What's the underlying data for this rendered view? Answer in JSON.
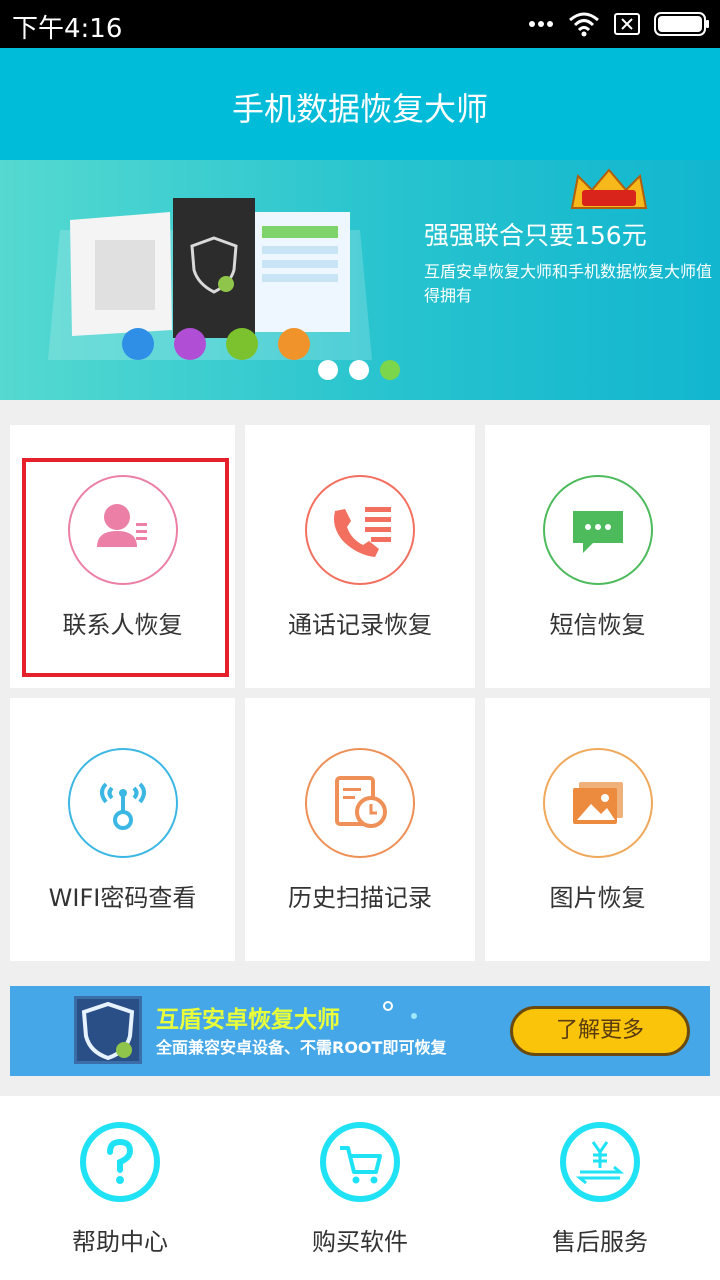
{
  "status_bar": {
    "time": "下午4:16"
  },
  "header": {
    "title": "手机数据恢复大师"
  },
  "banner": {
    "headline": "强强联合只要156元",
    "subtitle": "互盾安卓恢复大师和手机数据恢复大师值得拥有",
    "active_slide": 3,
    "slide_count": 3
  },
  "grid": {
    "items": [
      {
        "label": "联系人恢复",
        "icon": "contact-icon",
        "color": "#ec7fa6"
      },
      {
        "label": "通话记录恢复",
        "icon": "call-log-icon",
        "color": "#f36f5f"
      },
      {
        "label": "短信恢复",
        "icon": "sms-icon",
        "color": "#4dbb5c"
      },
      {
        "label": "WIFI密码查看",
        "icon": "wifi-key-icon",
        "color": "#3cb7e3"
      },
      {
        "label": "历史扫描记录",
        "icon": "history-icon",
        "color": "#ee9057"
      },
      {
        "label": "图片恢复",
        "icon": "photo-icon",
        "color": "#f0a85b"
      }
    ]
  },
  "ad": {
    "title": "互盾安卓恢复大师",
    "subtitle": "全面兼容安卓设备、不需ROOT即可恢复",
    "button": "了解更多"
  },
  "bottom_nav": {
    "items": [
      {
        "label": "帮助中心",
        "icon": "question-icon"
      },
      {
        "label": "购买软件",
        "icon": "cart-icon"
      },
      {
        "label": "售后服务",
        "icon": "yuan-exchange-icon"
      }
    ]
  },
  "colors": {
    "primary": "#00bcd9",
    "highlight": "#e5202a",
    "bottom_icon": "#20e2f5"
  }
}
